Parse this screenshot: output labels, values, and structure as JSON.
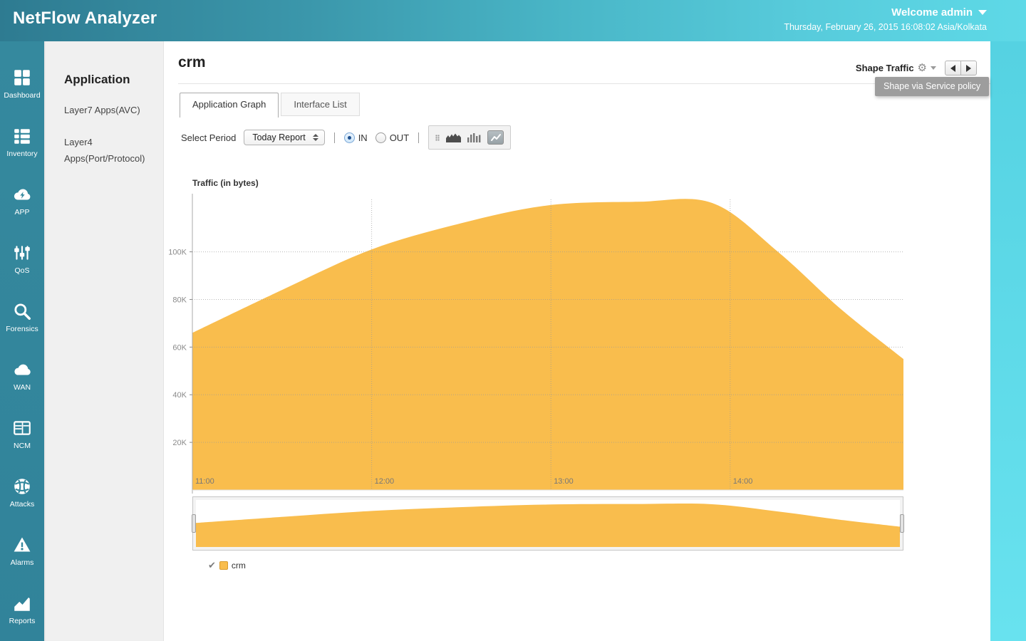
{
  "header": {
    "app_title": "NetFlow Analyzer",
    "welcome": "Welcome admin",
    "datetime": "Thursday, February 26, 2015 16:08:02 Asia/Kolkata"
  },
  "sidebar": {
    "items": [
      {
        "label": "Dashboard",
        "icon": "dashboard-icon"
      },
      {
        "label": "Inventory",
        "icon": "inventory-icon"
      },
      {
        "label": "APP",
        "icon": "app-cloud-icon"
      },
      {
        "label": "QoS",
        "icon": "qos-sliders-icon"
      },
      {
        "label": "Forensics",
        "icon": "forensics-search-icon"
      },
      {
        "label": "WAN",
        "icon": "wan-cloud-icon"
      },
      {
        "label": "NCM",
        "icon": "ncm-window-icon"
      },
      {
        "label": "Attacks",
        "icon": "attacks-globe-icon"
      },
      {
        "label": "Alarms",
        "icon": "alarms-warning-icon"
      },
      {
        "label": "Reports",
        "icon": "reports-chart-icon"
      }
    ]
  },
  "subsidebar": {
    "title": "Application",
    "items": [
      "Layer7 Apps(AVC)",
      "Layer4 Apps(Port/Protocol)"
    ]
  },
  "main": {
    "page_title": "crm",
    "tabs": [
      {
        "label": "Application Graph",
        "active": true
      },
      {
        "label": "Interface List",
        "active": false
      }
    ],
    "shape_traffic": {
      "label": "Shape Traffic",
      "gear_glyph": "⚙",
      "tooltip": "Shape via Service policy"
    },
    "controls": {
      "select_period_label": "Select Period",
      "period_value": "Today Report",
      "direction_options": [
        "IN",
        "OUT"
      ],
      "direction_selected": "IN"
    },
    "legend": {
      "check_glyph": "✔",
      "name": "crm",
      "color": "#F9BD4D"
    }
  },
  "chart_data": {
    "type": "area",
    "title": "Traffic (in bytes)",
    "x_range_minutes": [
      0,
      238
    ],
    "y_max": 122000,
    "grid": "dotted",
    "legend_position": "bottom",
    "navigator": true,
    "x_ticks": [
      {
        "label": "11:00",
        "minutes": 0
      },
      {
        "label": "12:00",
        "minutes": 60
      },
      {
        "label": "13:00",
        "minutes": 120
      },
      {
        "label": "14:00",
        "minutes": 180
      }
    ],
    "y_ticks": [
      {
        "label": "20K",
        "value": 20000
      },
      {
        "label": "40K",
        "value": 40000
      },
      {
        "label": "60K",
        "value": 60000
      },
      {
        "label": "80K",
        "value": 80000
      },
      {
        "label": "100K",
        "value": 100000
      }
    ],
    "series": [
      {
        "name": "crm",
        "color": "#F9BD4D",
        "points": [
          {
            "t": "11:00",
            "minutes": 0,
            "value": 66000
          },
          {
            "t": "11:30",
            "minutes": 30,
            "value": 84000
          },
          {
            "t": "12:00",
            "minutes": 60,
            "value": 101000
          },
          {
            "t": "12:30",
            "minutes": 90,
            "value": 112000
          },
          {
            "t": "12:59",
            "minutes": 119,
            "value": 119500
          },
          {
            "t": "13:29",
            "minutes": 149,
            "value": 121000
          },
          {
            "t": "13:54",
            "minutes": 174,
            "value": 120500
          },
          {
            "t": "14:16",
            "minutes": 196,
            "value": 100000
          },
          {
            "t": "14:37",
            "minutes": 217,
            "value": 76000
          },
          {
            "t": "14:58",
            "minutes": 238,
            "value": 55000
          }
        ]
      }
    ]
  }
}
